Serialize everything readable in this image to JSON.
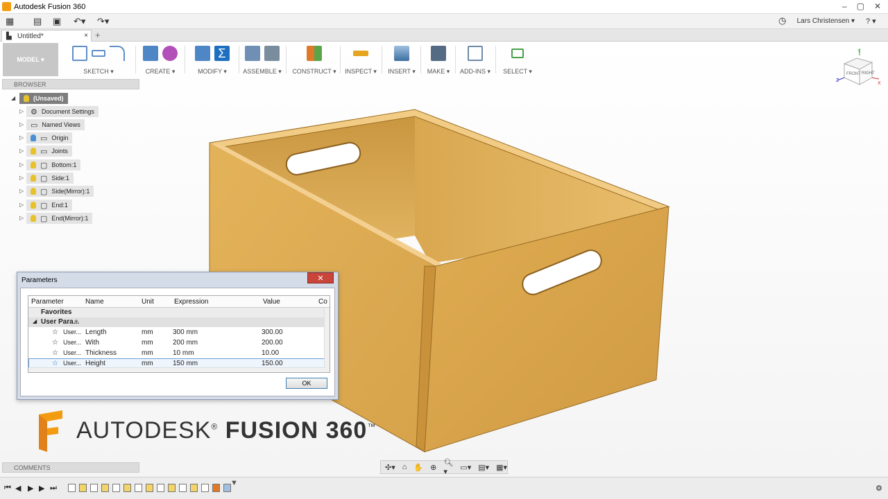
{
  "app": {
    "title": "Autodesk Fusion 360"
  },
  "window_controls": {
    "minimize": "–",
    "maximize": "▢",
    "close": "✕"
  },
  "qat": {
    "user": "Lars Christensen ▾",
    "help": "? ▾"
  },
  "document_tab": {
    "name": "Untitled*",
    "close": "×",
    "add": "+"
  },
  "ribbon": {
    "workspace": "MODEL ▾",
    "groups": [
      {
        "label": "SKETCH ▾"
      },
      {
        "label": "CREATE ▾"
      },
      {
        "label": "MODIFY ▾"
      },
      {
        "label": "ASSEMBLE ▾"
      },
      {
        "label": "CONSTRUCT ▾"
      },
      {
        "label": "INSPECT ▾"
      },
      {
        "label": "INSERT ▾"
      },
      {
        "label": "MAKE ▾"
      },
      {
        "label": "ADD-INS ▾"
      },
      {
        "label": "SELECT ▾"
      }
    ]
  },
  "browser": {
    "title": "BROWSER",
    "root": "(Unsaved)",
    "items": [
      {
        "label": "Document Settings"
      },
      {
        "label": "Named Views"
      },
      {
        "label": "Origin"
      },
      {
        "label": "Joints"
      },
      {
        "label": "Bottom:1"
      },
      {
        "label": "Side:1"
      },
      {
        "label": "Side(Mirror):1"
      },
      {
        "label": "End:1"
      },
      {
        "label": "End(Mirror):1"
      }
    ]
  },
  "comments": {
    "title": "COMMENTS"
  },
  "viewcube": {
    "front": "FRONT",
    "right": "RIGHT",
    "axis_x": "X",
    "axis_y": "Y",
    "axis_z": "Z"
  },
  "parameters_dialog": {
    "title": "Parameters",
    "close": "✕",
    "columns": [
      "Parameter",
      "Name",
      "Unit",
      "Expression",
      "Value",
      "Co"
    ],
    "favorites": "Favorites",
    "section": "User Para...",
    "rows": [
      {
        "param": "User...",
        "name": "Length",
        "unit": "mm",
        "expression": "300 mm",
        "value": "300.00"
      },
      {
        "param": "User...",
        "name": "With",
        "unit": "mm",
        "expression": "200 mm",
        "value": "200.00"
      },
      {
        "param": "User...",
        "name": "Thickness",
        "unit": "mm",
        "expression": "10 mm",
        "value": "10.00"
      },
      {
        "param": "User...",
        "name": "Height",
        "unit": "mm",
        "expression": "150 mm",
        "value": "150.00"
      }
    ],
    "ok_label": "OK"
  },
  "branding": {
    "name_light": "AUTODESK",
    "reg": "®",
    "name_bold": "FUSION 360",
    "tm": "™"
  },
  "colors": {
    "wood": "#dcaa4c",
    "wood_dark": "#b8862e",
    "accent_blue": "#1e6fbf",
    "logo_orange": "#f39c12"
  }
}
